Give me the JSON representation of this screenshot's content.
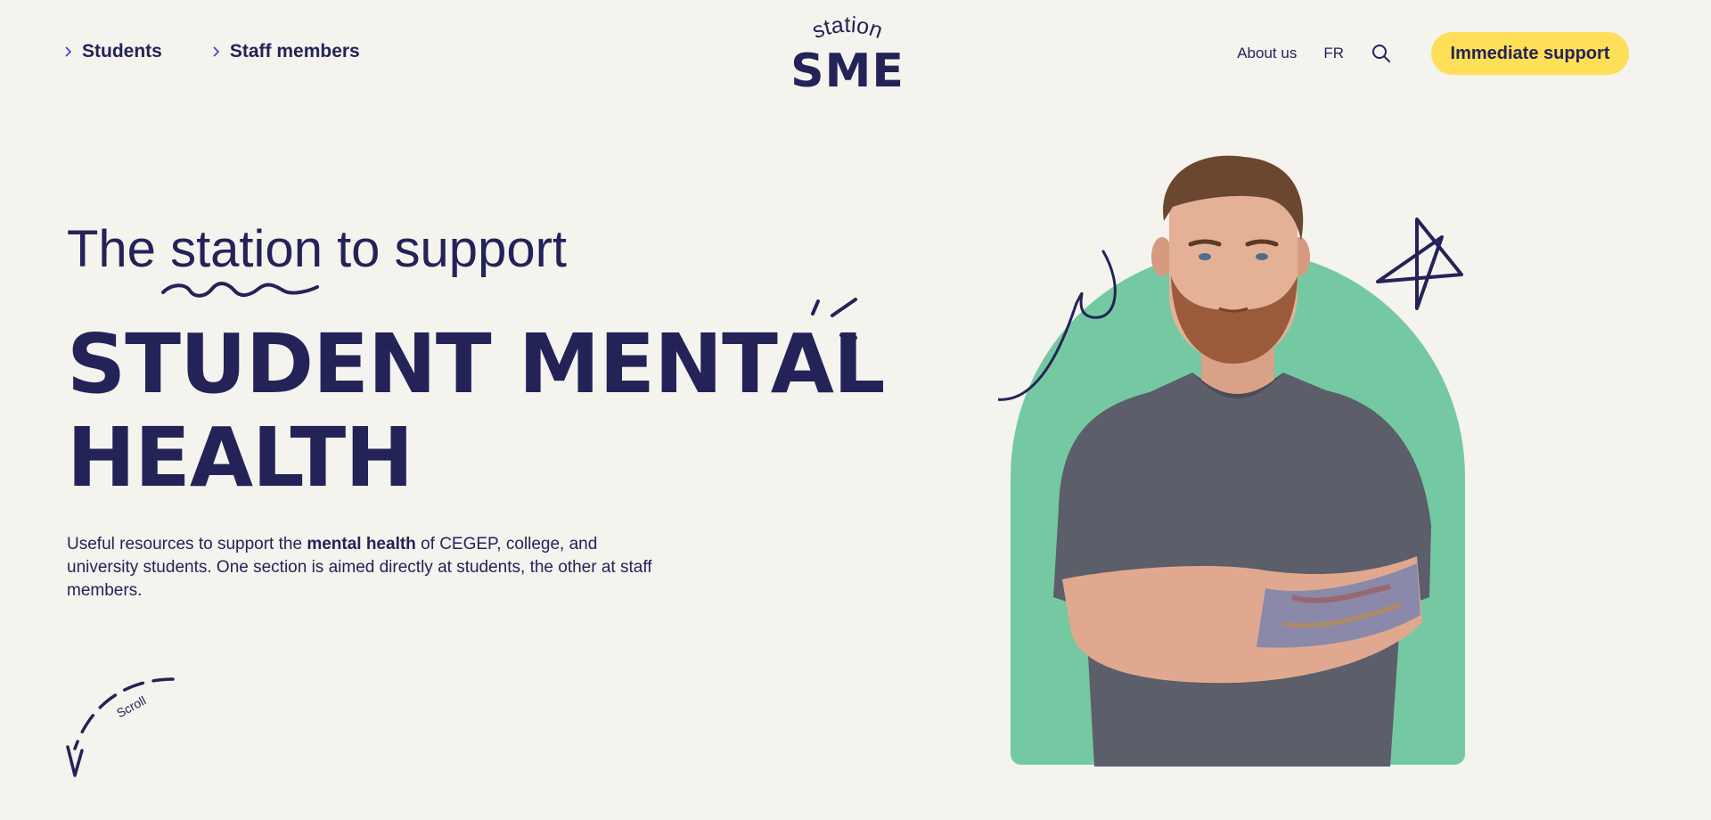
{
  "header": {
    "nav_left": [
      {
        "label": "Students"
      },
      {
        "label": "Staff members"
      }
    ],
    "logo": {
      "top_text": "station",
      "main_text": "SME"
    },
    "nav_right": {
      "about_label": "About us",
      "language_label": "FR",
      "search_icon": "search-icon",
      "cta_label": "Immediate support"
    }
  },
  "hero": {
    "lead_before": "The ",
    "lead_highlight": "station",
    "lead_after": " to support",
    "title_line1": "STUDENT MENTAL",
    "title_line2": "HEALTH",
    "desc_before": "Useful resources to support the ",
    "desc_bold": "mental health",
    "desc_after": " of CEGEP, college, and university students. One section is aimed directly at students, the other at staff members.",
    "scroll_label": "Scroll"
  },
  "colors": {
    "navy": "#242358",
    "background": "#f4f3ee",
    "cta_yellow": "#ffdf57",
    "arch_green": "#74c9a2"
  }
}
